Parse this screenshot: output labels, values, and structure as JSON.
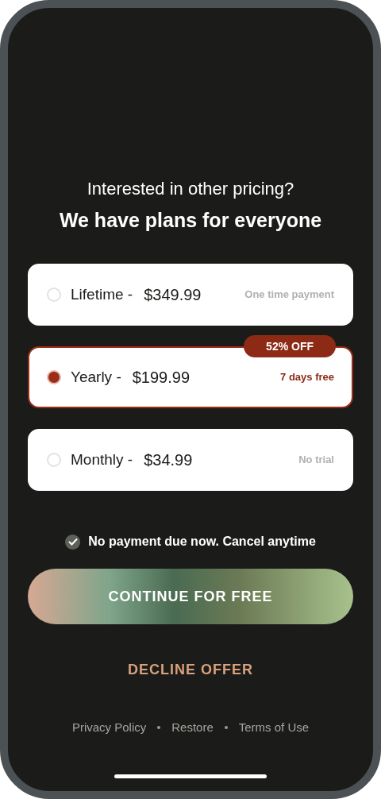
{
  "heading": {
    "subtitle": "Interested in other pricing?",
    "title": "We have plans for everyone"
  },
  "plans": [
    {
      "label": "Lifetime -",
      "price": "$349.99",
      "note": "One time payment",
      "selected": false
    },
    {
      "label": "Yearly -",
      "price": "$199.99",
      "note": "7 days free",
      "selected": true,
      "badge": "52% OFF"
    },
    {
      "label": "Monthly -",
      "price": "$34.99",
      "note": "No trial",
      "selected": false
    }
  ],
  "consent": {
    "text": "No payment due now. Cancel anytime",
    "checked": true
  },
  "continue_button": "CONTINUE FOR FREE",
  "decline_button": "DECLINE OFFER",
  "footer_links": [
    "Privacy Policy",
    "Restore",
    "Terms of Use"
  ]
}
